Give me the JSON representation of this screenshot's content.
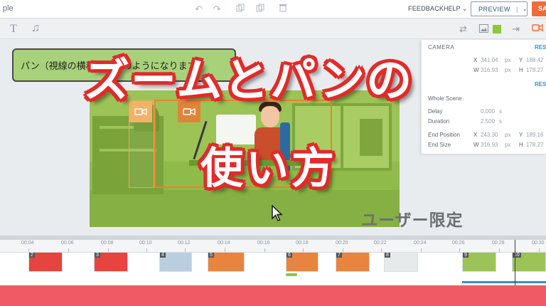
{
  "app": {
    "title_fragment": "ple"
  },
  "topbar": {
    "feedback_label": "FEEDBACK",
    "help_label": "HELP",
    "help_chevron": "⌄",
    "preview_label": "PREVIEW",
    "preview_separator": "|",
    "preview_chevron": "⌄",
    "save_label": "SA"
  },
  "canvas": {
    "speech_bubble_text": "パン（視線の横移動）このようになります"
  },
  "camera_panel": {
    "heading": "CAMERA",
    "reset_link": "RES",
    "reset_link_2": "RES",
    "x_label": "X",
    "x_value": "341.04",
    "y_label": "Y",
    "y_value": "188.42",
    "w_label": "W",
    "w_value": "316.93",
    "h_label": "H",
    "h_value": "178.27",
    "unit": "px",
    "whole_scene": "Whole Scene",
    "delay_label": "Delay",
    "delay_value": "0.000",
    "duration_label": "Duration",
    "duration_value": "2.500",
    "seconds_unit": "s",
    "end_position_label": "End Position",
    "end_x_value": "243.30",
    "end_y_value": "189.16",
    "end_size_label": "End Size",
    "end_w_value": "316.93",
    "end_h_value": "178.27"
  },
  "overlay": {
    "caption_line1": "ズームとパンの",
    "caption_line2": "使い方",
    "watermark": "ユーザー限定"
  },
  "timeline": {
    "ticks": [
      "00:04",
      "00:06",
      "00:08",
      "00:10",
      "00:12",
      "00:14",
      "00:16",
      "00:18",
      "00:20",
      "00:22",
      "00:24",
      "00:26",
      "00:28",
      "00:30"
    ],
    "clips": [
      {
        "number": "2",
        "color": "#e5443f"
      },
      {
        "number": "3",
        "color": "#e5443f"
      },
      {
        "number": "4",
        "color": "#b9cfe0"
      },
      {
        "number": "5",
        "color": "#e8843e"
      },
      {
        "number": "6",
        "color": "#e8843e"
      },
      {
        "number": "7",
        "color": "#e8843e"
      },
      {
        "number": "8",
        "color": "#e6eaea"
      },
      {
        "number": "9",
        "color": "#9cc356"
      },
      {
        "number": "10",
        "color": "#9cc356"
      }
    ]
  },
  "colors": {
    "accent": "#f26b3a",
    "caption_outline": "#e12b2b",
    "bottom_bar": "#ef5a64",
    "scene_green": "#8fbb4a"
  },
  "icons": {
    "text_tool": "T",
    "music_tool": "♫",
    "camera": "▶",
    "undo": "↶",
    "redo": "↷"
  }
}
